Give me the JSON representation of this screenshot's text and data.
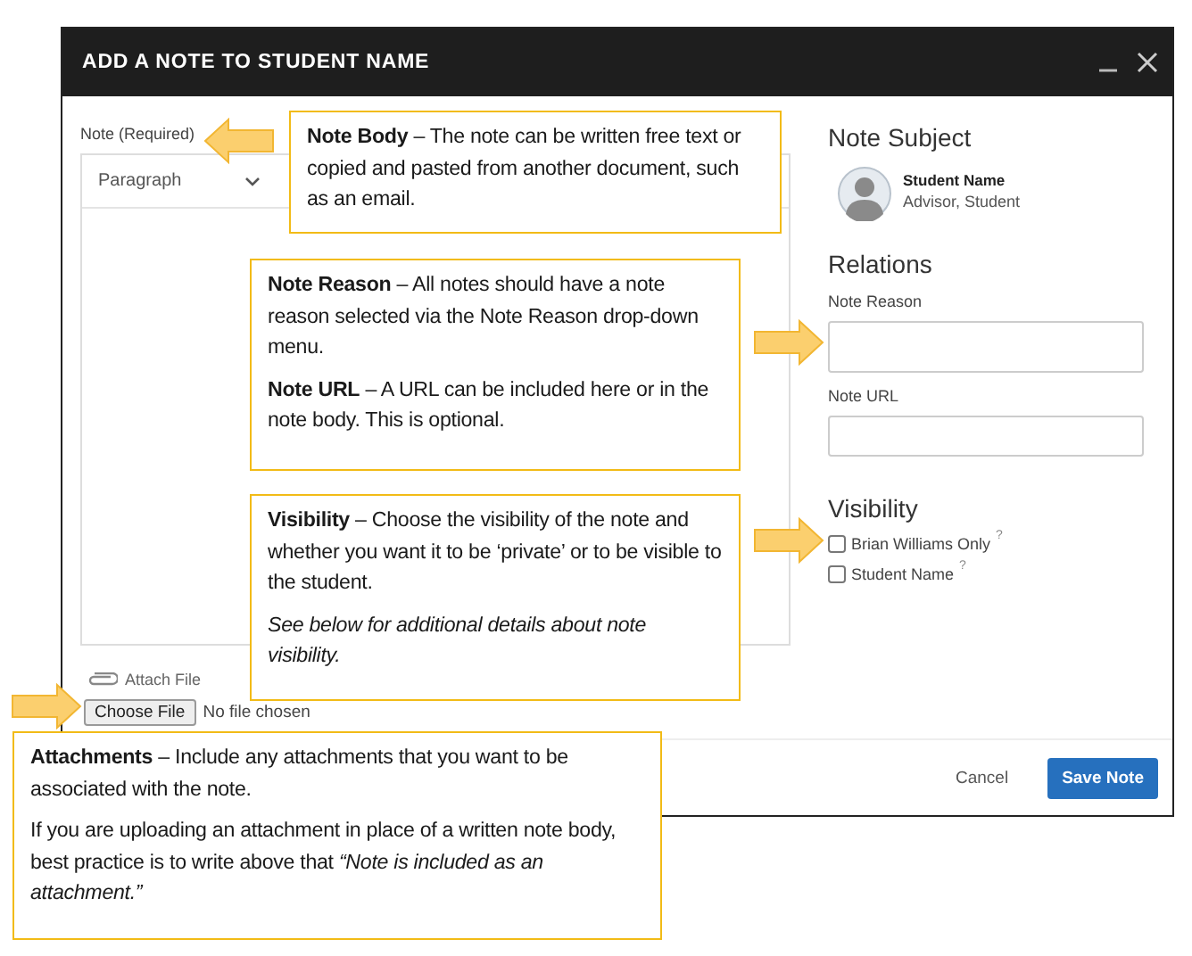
{
  "window": {
    "title": "ADD A NOTE TO STUDENT NAME"
  },
  "note_field": {
    "label": "Note (Required)",
    "format": "Paragraph"
  },
  "attach": {
    "label": "Attach File",
    "button": "Choose File",
    "status": "No file chosen"
  },
  "subject": {
    "heading": "Note Subject",
    "name": "Student Name",
    "roles": "Advisor, Student"
  },
  "relations": {
    "heading": "Relations",
    "fields": [
      {
        "label": "Note Reason",
        "kind": "select"
      },
      {
        "label": "Note URL",
        "kind": "text"
      }
    ]
  },
  "visibility": {
    "heading": "Visibility",
    "options": [
      {
        "label": "Brian Williams Only",
        "hint": "?",
        "checked": false
      },
      {
        "label": "Student Name",
        "hint": "?",
        "checked": false
      }
    ]
  },
  "buttons": [
    {
      "label": "Cancel",
      "kind": "link"
    },
    {
      "label": "Save Note",
      "kind": "primary"
    }
  ],
  "callouts": [
    {
      "paragraphs": [
        {
          "text": "**Note Body** – The note can be written free text or copied and pasted from another document, such as an email.",
          "italic": false
        }
      ]
    },
    {
      "paragraphs": [
        {
          "text": "**Note Reason** – All notes should have a note reason selected via the Note Reason drop-down menu.",
          "italic": false
        },
        {
          "text": "**Note URL** – A URL can be included here or in the note body. This is optional.",
          "italic": false
        }
      ]
    },
    {
      "paragraphs": [
        {
          "text": "**Visibility** – Choose the visibility of the note and whether you want it to be ‘private’ or to be visible to the student.",
          "italic": false
        },
        {
          "text": "See below for additional details about note visibility.",
          "italic": true
        }
      ]
    },
    {
      "paragraphs": [
        {
          "text": "**Attachments** – Include any attachments that you want to be associated with the note.",
          "italic": false
        },
        {
          "text": "If you are uploading an attachment in place of a written note body, best practice is to write above that *“Note is included as an attachment.”*",
          "italic": false
        }
      ]
    }
  ]
}
